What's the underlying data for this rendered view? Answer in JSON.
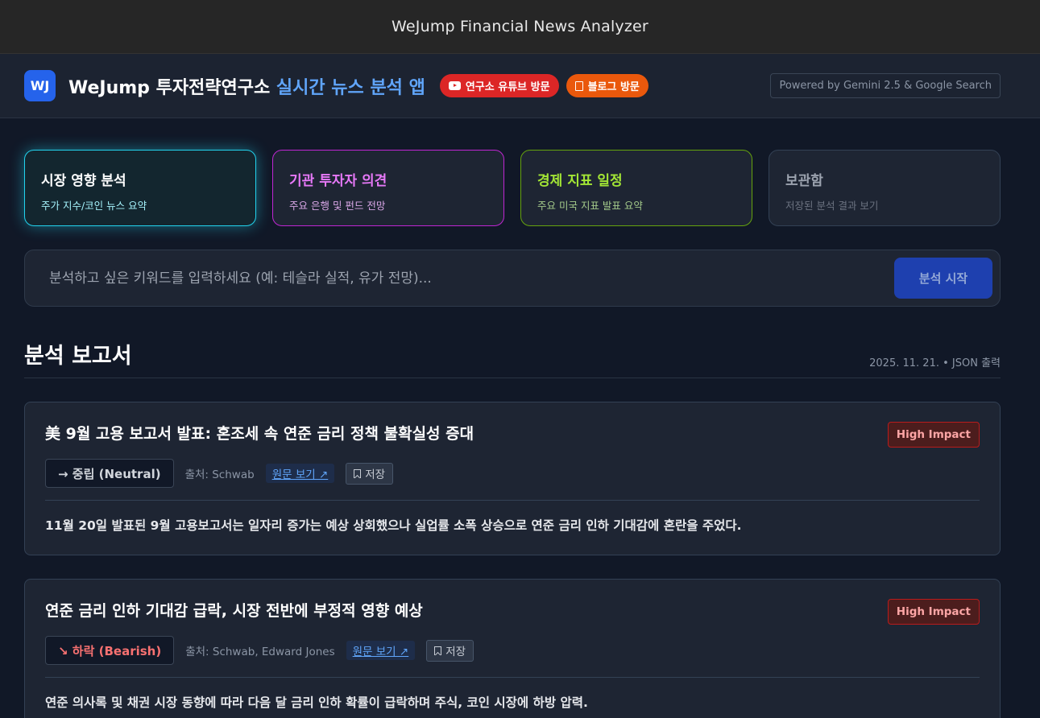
{
  "window": {
    "title": "WeJump Financial News Analyzer"
  },
  "header": {
    "logo": "WJ",
    "title_main": "WeJump 투자전략연구소 ",
    "title_accent": "실시간 뉴스 분석 앱",
    "youtube_label": "연구소 유튜브 방문",
    "blog_label": "블로그 방문",
    "powered_by": "Powered by Gemini 2.5 & Google Search"
  },
  "categories": [
    {
      "title": "시장 영향 분석",
      "subtitle": "주가 지수/코인 뉴스 요약",
      "active": true,
      "color": "#22d3ee"
    },
    {
      "title": "기관 투자자 의견",
      "subtitle": "주요 은행 및 펀드 전망",
      "active": false,
      "color": "#e879f9"
    },
    {
      "title": "경제 지표 일정",
      "subtitle": "주요 미국 지표 발표 요약",
      "active": false,
      "color": "#a3e635"
    },
    {
      "title": "보관함",
      "subtitle": "저장된 분석 결과 보기",
      "active": false,
      "color": "#9ca3af"
    }
  ],
  "search": {
    "placeholder": "분석하고 싶은 키워드를 입력하세요 (예: 테슬라 실적, 유가 전망)...",
    "button_label": "분석 시작"
  },
  "report_section": {
    "title": "분석 보고서",
    "meta": "2025. 11. 21. • JSON 출력"
  },
  "reports": [
    {
      "title": "美 9월 고용 보고서 발표: 혼조세 속 연준 금리 정책 불확실성 증대",
      "impact": "High Impact",
      "sentiment": "→ 중립 (Neutral)",
      "source": "출처: Schwab",
      "link_label": "원문 보기 ↗",
      "save_label": "저장",
      "summary": "11월 20일 발표된 9월 고용보고서는 일자리 증가는 예상 상회했으나 실업률 소폭 상승으로 연준 금리 인하 기대감에 혼란을 주었다."
    },
    {
      "title": "연준 금리 인하 기대감 급락, 시장 전반에 부정적 영향 예상",
      "impact": "High Impact",
      "sentiment": "↘ 하락 (Bearish)",
      "source": "출처: Schwab, Edward Jones",
      "link_label": "원문 보기 ↗",
      "save_label": "저장",
      "summary": "연준 의사록 및 채권 시장 동향에 따라 다음 달 금리 인하 확률이 급락하며 주식, 코인 시장에 하방 압력."
    }
  ]
}
